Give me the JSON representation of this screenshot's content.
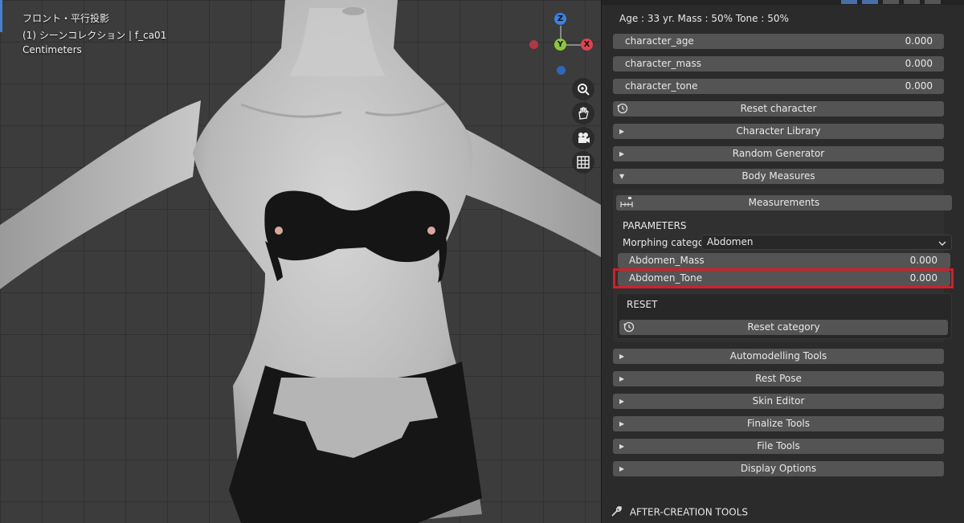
{
  "viewport": {
    "view_name": "フロント・平行投影",
    "collection": "(1) シーンコレクション | f_ca01",
    "units": "Centimeters",
    "gizmo": {
      "z": "Z",
      "y": "Y",
      "x": "X"
    },
    "nav_icons": [
      "zoom-icon",
      "hand-icon",
      "camera-icon",
      "grid-icon"
    ]
  },
  "panel": {
    "info": "Age : 33 yr.  Mass : 50%  Tone : 50%",
    "sliders": [
      {
        "label": "character_age",
        "value": "0.000"
      },
      {
        "label": "character_mass",
        "value": "0.000"
      },
      {
        "label": "character_tone",
        "value": "0.000"
      }
    ],
    "reset_character": "Reset character",
    "sections_top": [
      {
        "label": "Character Library",
        "arrow": "▶"
      },
      {
        "label": "Random Generator",
        "arrow": "▶"
      },
      {
        "label": "Body Measures",
        "arrow": "▼"
      }
    ],
    "measurements": "Measurements",
    "parameters": "PARAMETERS",
    "morph_label": "Morphing categor..",
    "morph_value": "Abdomen",
    "morph_sliders": [
      {
        "label": "Abdomen_Mass",
        "value": "0.000"
      },
      {
        "label": "Abdomen_Tone",
        "value": "0.000"
      }
    ],
    "reset_heading": "RESET",
    "reset_category": "Reset category",
    "sections_bottom": [
      {
        "label": "Automodelling Tools",
        "arrow": "▶"
      },
      {
        "label": "Rest Pose",
        "arrow": "▶"
      },
      {
        "label": "Skin Editor",
        "arrow": "▶"
      },
      {
        "label": "Finalize Tools",
        "arrow": "▶"
      },
      {
        "label": "File Tools",
        "arrow": "▶"
      },
      {
        "label": "Display Options",
        "arrow": "▶"
      }
    ],
    "after_creation": "AFTER-CREATION TOOLS"
  },
  "colors": {
    "highlight": "#d0202a",
    "axis_z": "#3b82e0",
    "axis_y": "#8cc63f",
    "axis_x": "#e0434f"
  }
}
